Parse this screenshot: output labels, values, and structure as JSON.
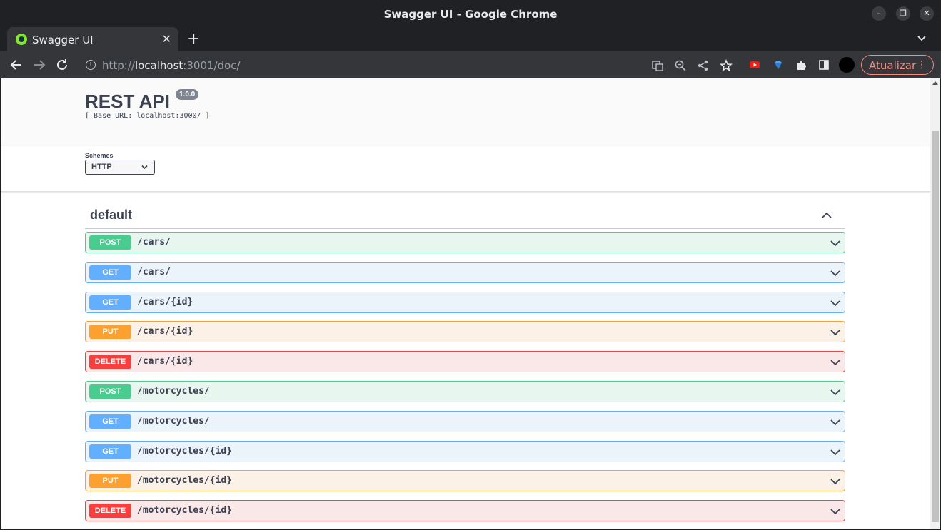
{
  "window": {
    "title": "Swagger UI - Google Chrome"
  },
  "tabs": [
    {
      "title": "Swagger UI"
    }
  ],
  "toolbar": {
    "url_prefix": "http://",
    "url_host": "localhost",
    "url_rest": ":3001/doc/",
    "update_label": "Atualizar"
  },
  "swagger": {
    "title": "REST API",
    "version": "1.0.0",
    "base_url": "[ Base URL: localhost:3000/ ]",
    "schemes_label": "Schemes",
    "scheme_selected": "HTTP",
    "tag": "default"
  },
  "operations": [
    {
      "method": "POST",
      "path": "/cars/"
    },
    {
      "method": "GET",
      "path": "/cars/"
    },
    {
      "method": "GET",
      "path": "/cars/{id}"
    },
    {
      "method": "PUT",
      "path": "/cars/{id}"
    },
    {
      "method": "DELETE",
      "path": "/cars/{id}"
    },
    {
      "method": "POST",
      "path": "/motorcycles/"
    },
    {
      "method": "GET",
      "path": "/motorcycles/"
    },
    {
      "method": "GET",
      "path": "/motorcycles/{id}"
    },
    {
      "method": "PUT",
      "path": "/motorcycles/{id}"
    },
    {
      "method": "DELETE",
      "path": "/motorcycles/{id}"
    }
  ],
  "colors": {
    "post": "#49cc90",
    "get": "#61affe",
    "put": "#fca130",
    "delete": "#f93e3e"
  }
}
